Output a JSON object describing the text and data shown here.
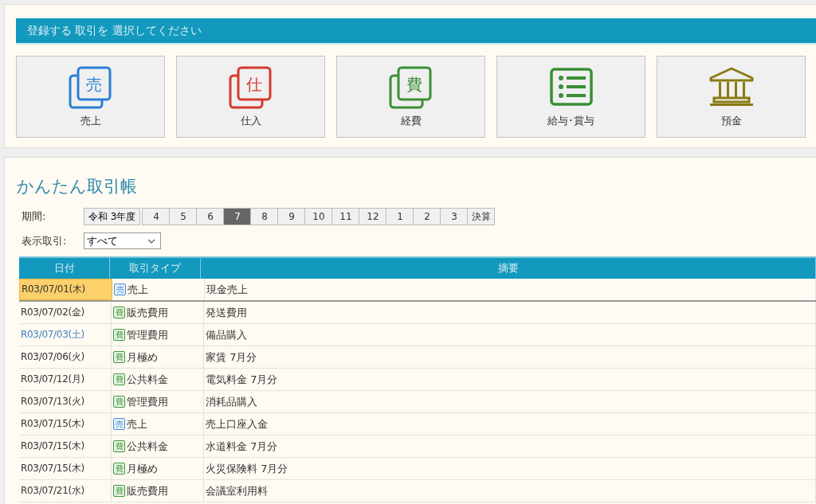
{
  "select_panel": {
    "heading": "登録する 取引を 選択してください",
    "tiles": [
      {
        "label": "売上",
        "kind": "stack",
        "icon_text": "売",
        "color": "#2a7fd4"
      },
      {
        "label": "仕入",
        "kind": "stack",
        "icon_text": "仕",
        "color": "#d33a2c"
      },
      {
        "label": "経費",
        "kind": "stack",
        "icon_text": "費",
        "color": "#3a8f35"
      },
      {
        "label": "給与･賞与",
        "kind": "list",
        "color": "#3a8f35"
      },
      {
        "label": "預金",
        "kind": "bank",
        "color": "#8a7a12"
      }
    ]
  },
  "ledger": {
    "title": "かんたん取引帳",
    "period": {
      "label": "期間:",
      "year": "令和 3年度",
      "months": [
        {
          "label": "4",
          "selected": false
        },
        {
          "label": "5",
          "selected": false
        },
        {
          "label": "6",
          "selected": false
        },
        {
          "label": "7",
          "selected": true
        },
        {
          "label": "8",
          "selected": false
        },
        {
          "label": "9",
          "selected": false
        },
        {
          "label": "10",
          "selected": false
        },
        {
          "label": "11",
          "selected": false
        },
        {
          "label": "12",
          "selected": false
        },
        {
          "label": "1",
          "selected": false
        },
        {
          "label": "2",
          "selected": false
        },
        {
          "label": "3",
          "selected": false
        },
        {
          "label": "決算",
          "selected": false
        }
      ]
    },
    "filter": {
      "label": "表示取引:",
      "value": "すべて"
    },
    "table": {
      "columns": [
        "日付",
        "取引タイプ",
        "摘要"
      ],
      "rows": [
        {
          "date": "R03/07/01(木)",
          "saturday": false,
          "selected": true,
          "badge": "売",
          "kind": "sales",
          "type": "売上",
          "summary": "現金売上"
        },
        {
          "date": "R03/07/02(金)",
          "saturday": false,
          "selected": false,
          "badge": "費",
          "kind": "expense",
          "type": "販売費用",
          "summary": "発送費用"
        },
        {
          "date": "R03/07/03(土)",
          "saturday": true,
          "selected": false,
          "badge": "費",
          "kind": "expense",
          "type": "管理費用",
          "summary": "備品購入"
        },
        {
          "date": "R03/07/06(火)",
          "saturday": false,
          "selected": false,
          "badge": "費",
          "kind": "expense",
          "type": "月極め",
          "summary": "家賃 7月分"
        },
        {
          "date": "R03/07/12(月)",
          "saturday": false,
          "selected": false,
          "badge": "費",
          "kind": "expense",
          "type": "公共料金",
          "summary": "電気料金 7月分"
        },
        {
          "date": "R03/07/13(火)",
          "saturday": false,
          "selected": false,
          "badge": "費",
          "kind": "expense",
          "type": "管理費用",
          "summary": "消耗品購入"
        },
        {
          "date": "R03/07/15(木)",
          "saturday": false,
          "selected": false,
          "badge": "売",
          "kind": "sales",
          "type": "売上",
          "summary": "売上口座入金"
        },
        {
          "date": "R03/07/15(木)",
          "saturday": false,
          "selected": false,
          "badge": "費",
          "kind": "expense",
          "type": "公共料金",
          "summary": "水道料金 7月分"
        },
        {
          "date": "R03/07/15(木)",
          "saturday": false,
          "selected": false,
          "badge": "費",
          "kind": "expense",
          "type": "月極め",
          "summary": "火災保険料 7月分"
        },
        {
          "date": "R03/07/21(水)",
          "saturday": false,
          "selected": false,
          "badge": "費",
          "kind": "expense",
          "type": "販売費用",
          "summary": "会議室利用料"
        }
      ]
    }
  }
}
